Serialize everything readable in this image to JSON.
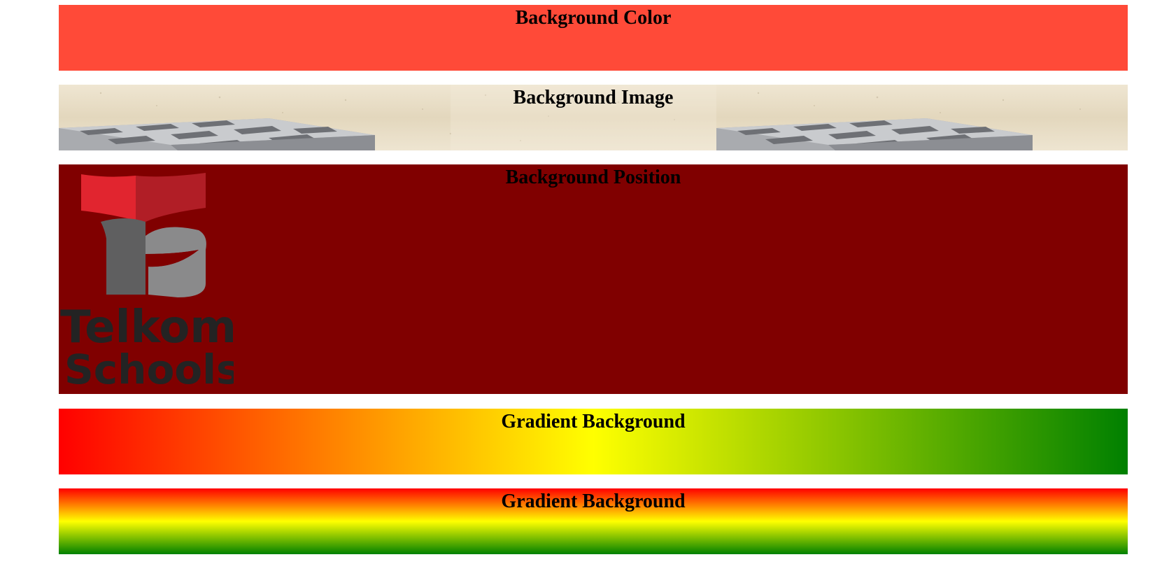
{
  "sections": [
    {
      "heading": "Background Color"
    },
    {
      "heading": "Background Image"
    },
    {
      "heading": "Background Position"
    },
    {
      "heading": "Gradient Background"
    },
    {
      "heading": "Gradient Background"
    }
  ],
  "logo": {
    "line1": "Telkom",
    "line2": "Schools"
  },
  "colors": {
    "background_color_box": "#ff4a38",
    "background_position_box": "#800000",
    "gradient": [
      "#ff0000",
      "#ffff00",
      "#008000"
    ],
    "logo_red": "#e1252f",
    "logo_red_dark": "#b11e26",
    "logo_gray": "#5f5f60",
    "logo_gray_light": "#8a8a8b",
    "logo_text": "#232323"
  },
  "icons": [
    "telkom-schools-logo",
    "stone-block-texture"
  ]
}
